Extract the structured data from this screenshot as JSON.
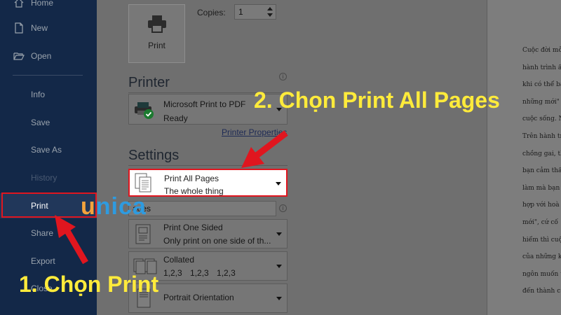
{
  "sidebar": {
    "items": [
      {
        "label": "Home",
        "icon": "home-icon"
      },
      {
        "label": "New",
        "icon": "new-document-icon"
      },
      {
        "label": "Open",
        "icon": "folder-open-icon"
      },
      {
        "label": "Info"
      },
      {
        "label": "Save"
      },
      {
        "label": "Save As"
      },
      {
        "label": "History"
      },
      {
        "label": "Print",
        "selected": true
      },
      {
        "label": "Share"
      },
      {
        "label": "Export"
      },
      {
        "label": "Close"
      }
    ]
  },
  "print_panel": {
    "print_button_label": "Print",
    "copies_label": "Copies:",
    "copies_value": "1",
    "printer_section_title": "Printer",
    "printer": {
      "name": "Microsoft Print to PDF",
      "status": "Ready"
    },
    "printer_properties_link": "Printer Properties",
    "settings_section_title": "Settings",
    "pages_setting": {
      "title": "Print All Pages",
      "subtitle": "The whole thing"
    },
    "pages_input_value": "aoes",
    "sided_setting": {
      "title": "Print One Sided",
      "subtitle": "Only print on one side of th..."
    },
    "collated_setting": {
      "title": "Collated",
      "subtitle": "1,2,3 1,2,3 1,2,3"
    },
    "orientation_setting": {
      "title": "Portrait Orientation"
    }
  },
  "preview": {
    "lines": [
      "Cuộc đời mỗ",
      "hành trình ấy",
      "khi có thể bạ",
      "những mới\"",
      "cuộc sống. N",
      "Trên hành tr",
      "chồng gai, th",
      "bạn cảm thấy",
      "làm mà bạn",
      "hợp với hoà",
      "mới\", cứ cố",
      "hiểm thì cuộ",
      "của những k",
      "ngôn muốn t",
      "đến thành c"
    ]
  },
  "annotations": {
    "watermark_u": "u",
    "watermark_rest": "nica",
    "step1": "1. Chọn Print",
    "step2": "2. Chọn Print All Pages"
  },
  "colors": {
    "sidebar_bg": "#132848",
    "highlight_red": "#e0161f",
    "callout_yellow": "#ffeb3b",
    "watermark_orange": "#f4a33c",
    "watermark_blue": "#2e9be0"
  }
}
